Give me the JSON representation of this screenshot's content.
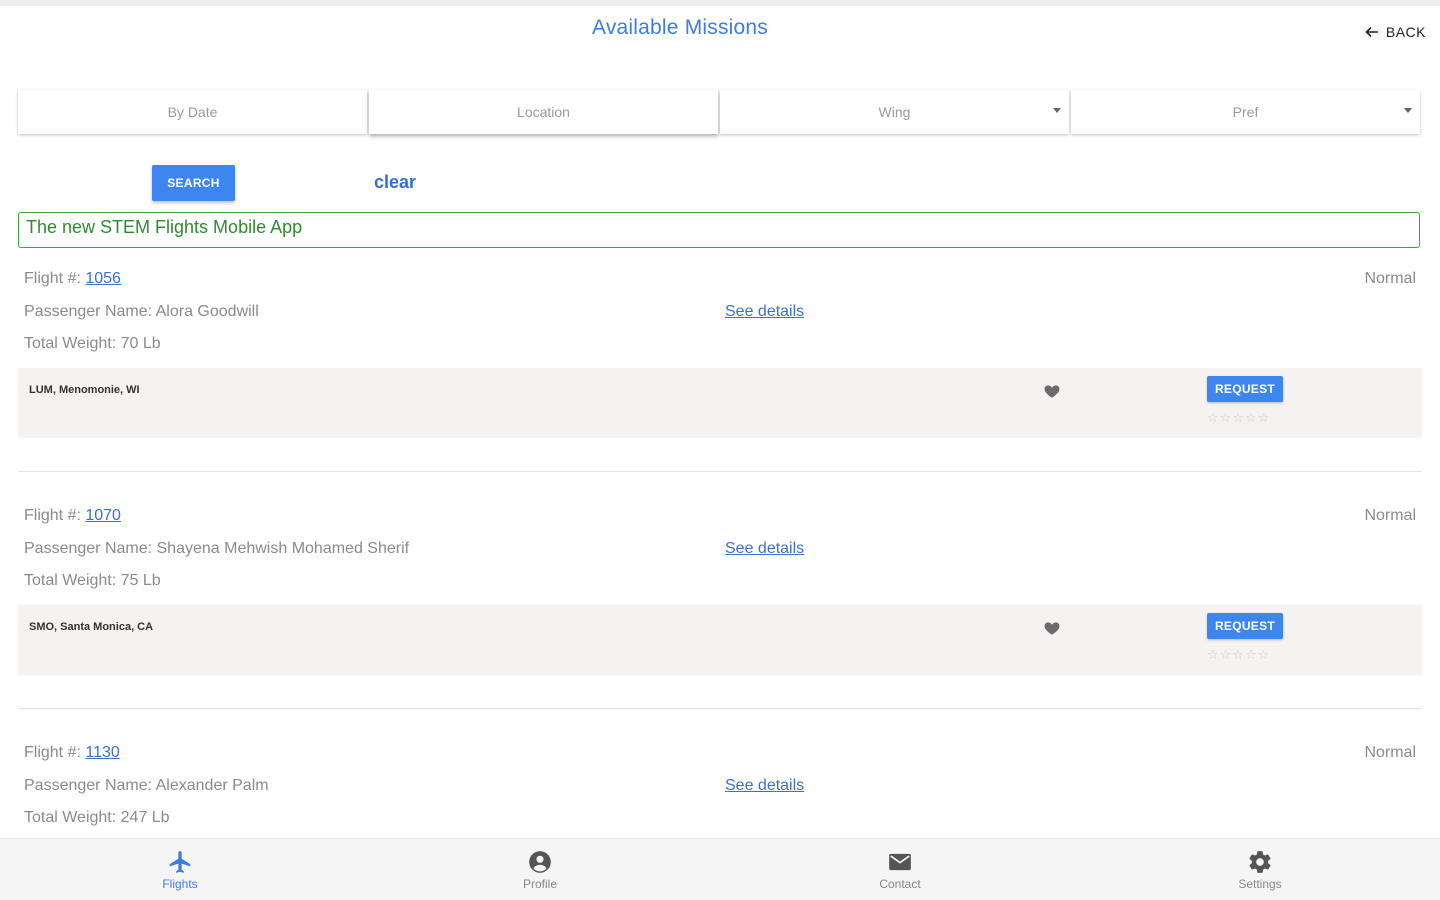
{
  "header": {
    "title": "Available Missions",
    "back_label": "BACK"
  },
  "filters": {
    "by_date": "By Date",
    "location": "Location",
    "wing": "Wing",
    "pref": "Pref"
  },
  "actions": {
    "search_label": "SEARCH",
    "clear_label": "clear"
  },
  "banner": {
    "text": "The new STEM Flights Mobile App"
  },
  "flights": [
    {
      "flight_label": "Flight #: ",
      "flight_number": "1056",
      "status": "Normal",
      "passenger": "Passenger Name: Alora Goodwill",
      "weight": "Total Weight: 70 Lb",
      "details_label": "See details",
      "location": "LUM, Menomonie, WI",
      "request_label": "REQUEST",
      "stars": "☆☆☆☆☆"
    },
    {
      "flight_label": "Flight #: ",
      "flight_number": "1070",
      "status": "Normal",
      "passenger": "Passenger Name: Shayena Mehwish Mohamed Sherif",
      "weight": "Total Weight: 75 Lb",
      "details_label": "See details",
      "location": "SMO, Santa Monica, CA",
      "request_label": "REQUEST",
      "stars": "☆☆☆☆☆"
    },
    {
      "flight_label": "Flight #: ",
      "flight_number": "1130",
      "status": "Normal",
      "passenger": "Passenger Name: Alexander Palm",
      "weight": "Total Weight: 247 Lb",
      "details_label": "See details"
    }
  ],
  "bottom_nav": {
    "flights": "Flights",
    "profile": "Profile",
    "contact": "Contact",
    "settings": "Settings"
  },
  "colors": {
    "accent": "#3d86f0",
    "banner_green": "#2e8b2e",
    "panel_bg": "#f6f2f1"
  }
}
